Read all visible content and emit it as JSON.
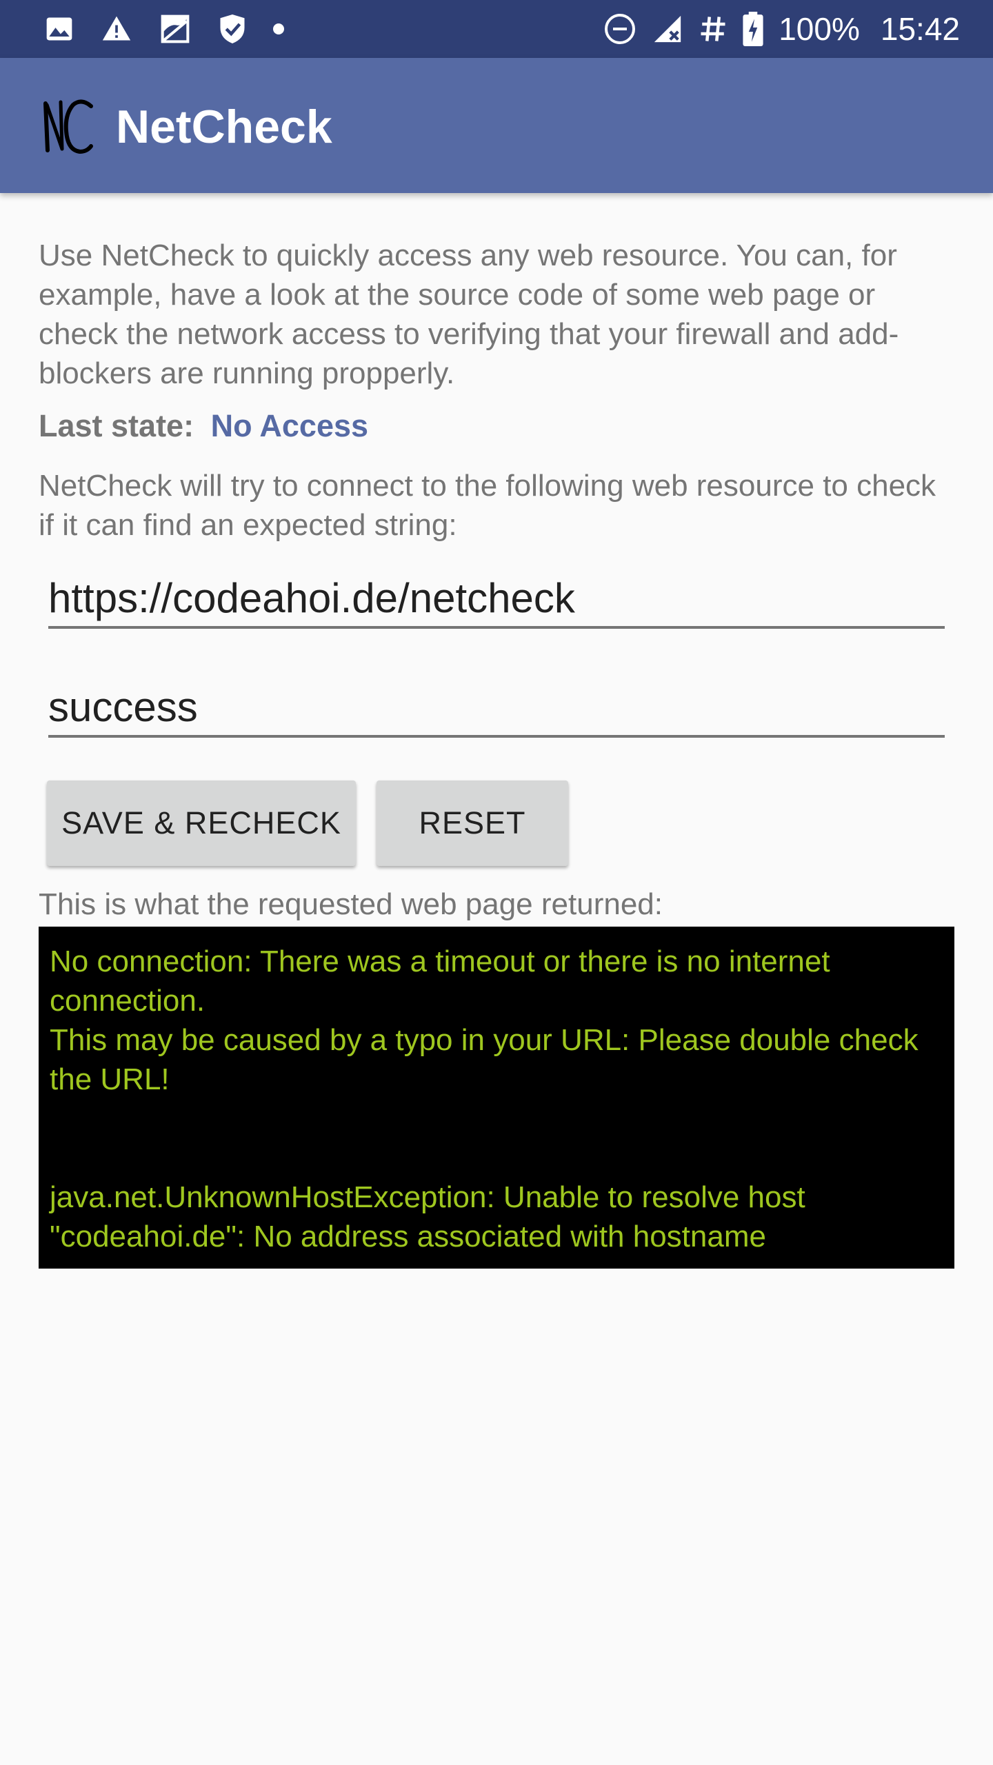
{
  "status_bar": {
    "left_icons": [
      "image-icon",
      "warning-icon",
      "sd-card-icon",
      "shield-check-icon",
      "dot-icon"
    ],
    "right_icons": [
      "do-not-disturb-icon",
      "no-signal-icon",
      "hash-icon",
      "battery-charging-icon"
    ],
    "battery": "100%",
    "time": "15:42",
    "background_color": "#2f3f75"
  },
  "app_bar": {
    "title": "NetCheck",
    "logo_text": "NC",
    "background_color": "#566aa4"
  },
  "main": {
    "intro": "Use NetCheck to quickly access any web resource. You can, for example, have a look at the source code of some web page or check the network access to verifying that your firewall and add-blockers are running propperly.",
    "last_state_label": "Last state:",
    "last_state_value": "No Access",
    "connect_description": "NetCheck will try to connect to the following web resource to check if it can find an expected string:",
    "url_value": "https://codeahoi.de/netcheck",
    "expected_string_value": "success",
    "save_button_label": "SAVE & RECHECK",
    "reset_button_label": "RESET",
    "returned_label": "This is what the requested web page returned:",
    "output": "No connection: There was a timeout or there is no internet connection.\nThis may be caused by a typo in your URL: Please double check the URL!\n\n\njava.net.UnknownHostException: Unable to resolve host \"codeahoi.de\": No address associated with hostname",
    "output_text_color": "#9fc71f",
    "accent_color": "#566aa4"
  }
}
